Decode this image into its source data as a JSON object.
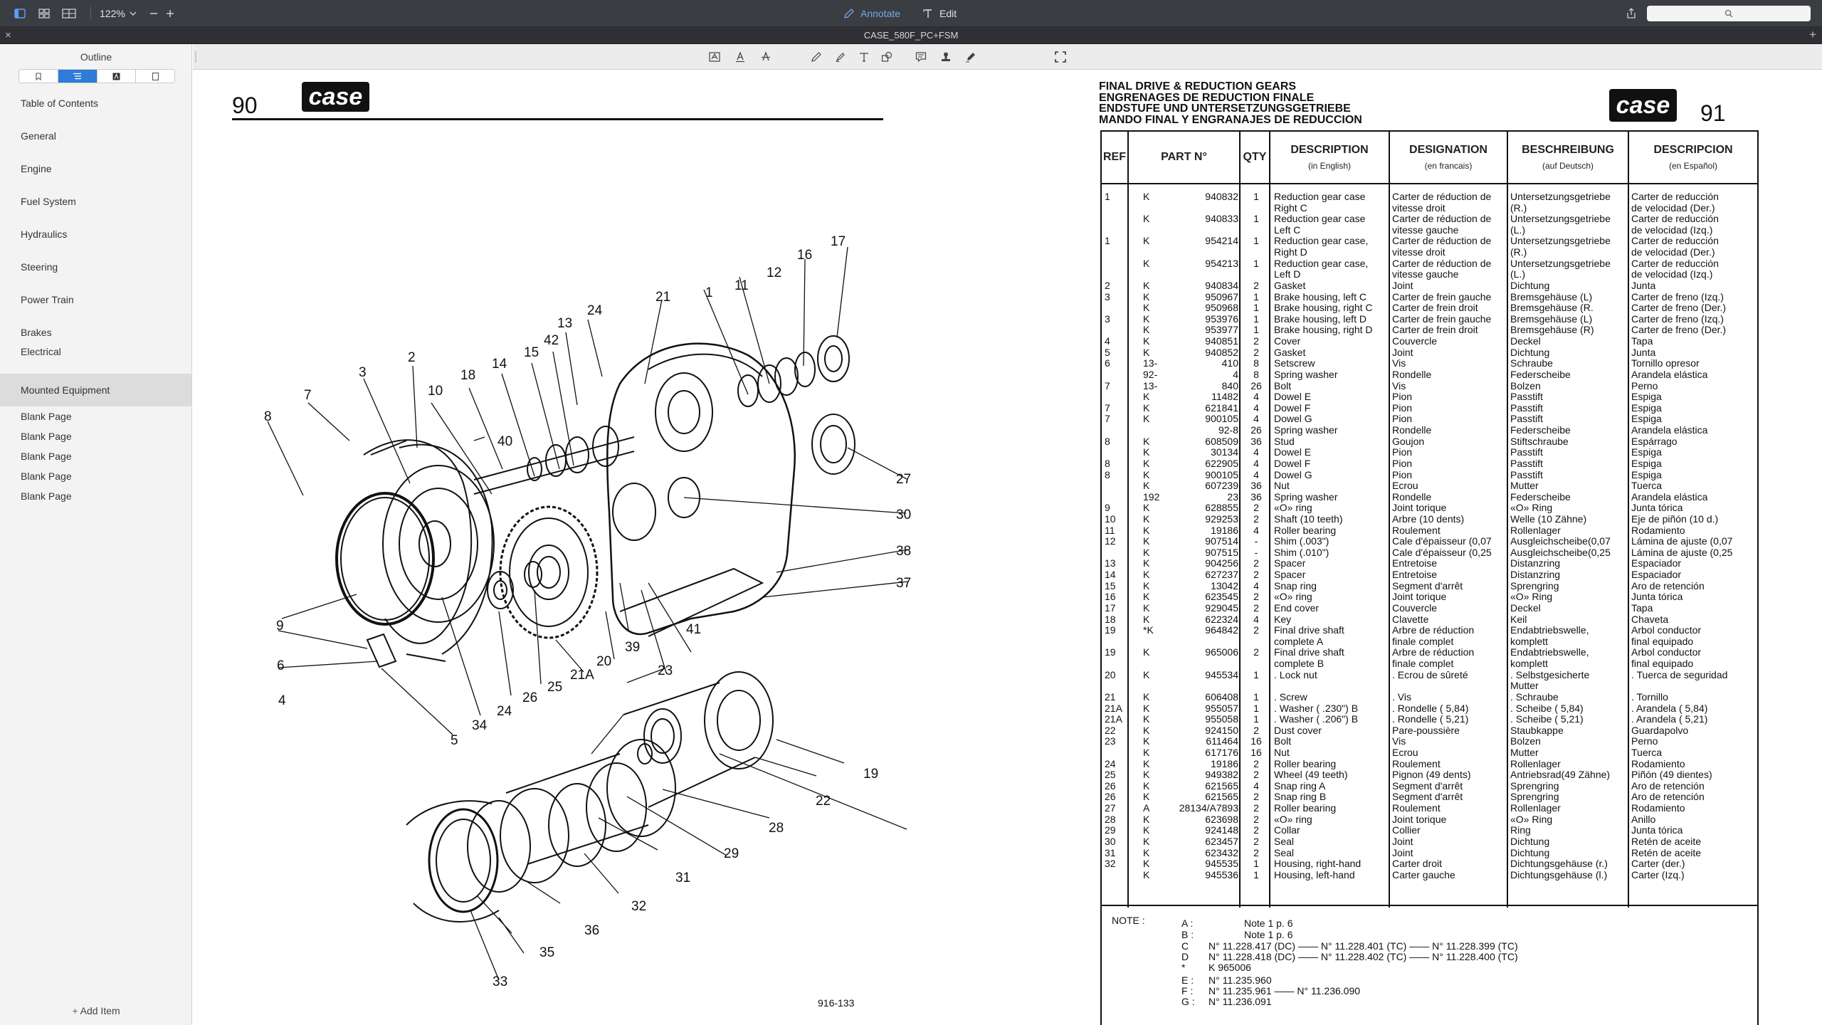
{
  "toolbar": {
    "zoom": "122%",
    "annotate_label": "Annotate",
    "edit_label": "Edit"
  },
  "titlebar": {
    "title": "CASE_580F_PC+FSM"
  },
  "sidebar": {
    "title": "Outline",
    "items": [
      {
        "label": "Table of Contents"
      },
      {
        "label": "General"
      },
      {
        "label": "Engine"
      },
      {
        "label": "Fuel System"
      },
      {
        "label": "Hydraulics"
      },
      {
        "label": "Steering"
      },
      {
        "label": "Power Train"
      },
      {
        "label": "Brakes"
      },
      {
        "label": "Electrical"
      },
      {
        "label": "Mounted Equipment"
      },
      {
        "label": "Blank Page"
      },
      {
        "label": "Blank Page"
      },
      {
        "label": "Blank Page"
      },
      {
        "label": "Blank Page"
      },
      {
        "label": "Blank Page"
      }
    ],
    "add_item": "Add Item"
  },
  "doc": {
    "left_page": "90",
    "right_page": "91",
    "logo": "case",
    "figure_code": "916-133",
    "heading": [
      "FINAL DRIVE & REDUCTION GEARS",
      "ENGRENAGES DE REDUCTION FINALE",
      "ENDSTUFE UND UNTERSETZUNGSGETRIEBE",
      "MANDO FINAL Y ENGRANAJES DE REDUCCION"
    ],
    "table_headers": {
      "ref": "REF",
      "part": "PART N°",
      "qty": "QTY",
      "desc_en": "DESCRIPTION",
      "desc_en_sub": "(in English)",
      "desc_fr": "DESIGNATION",
      "desc_fr_sub": "(en francais)",
      "desc_de": "BESCHREIBUNG",
      "desc_de_sub": "(auf Deutsch)",
      "desc_es": "DESCRIPCION",
      "desc_es_sub": "(en Español)"
    },
    "rows": [
      {
        "ref": "1",
        "k": "K",
        "part": "940832",
        "qty": "1",
        "en": "Reduction gear case",
        "fr": "Carter de réduction de",
        "de": "Untersetzungsgetriebe",
        "es": "Carter de reducción"
      },
      {
        "ref": "",
        "k": "",
        "part": "",
        "qty": "",
        "en": "Right            C",
        "fr": "vitesse droit",
        "de": "(R.)",
        "es": "de velocidad (Der.)"
      },
      {
        "ref": "",
        "k": "K",
        "part": "940833",
        "qty": "1",
        "en": "Reduction gear case",
        "fr": "Carter de réduction de",
        "de": "Untersetzungsgetriebe",
        "es": "Carter de reducción"
      },
      {
        "ref": "",
        "k": "",
        "part": "",
        "qty": "",
        "en": "Left               C",
        "fr": "vitesse gauche",
        "de": "(L.)",
        "es": "de velocidad (Izq.)"
      },
      {
        "ref": "1",
        "k": "K",
        "part": "954214",
        "qty": "1",
        "en": "Reduction gear case,",
        "fr": "Carter de réduction de",
        "de": "Untersetzungsgetriebe",
        "es": "Carter de reducción"
      },
      {
        "ref": "",
        "k": "",
        "part": "",
        "qty": "",
        "en": "Right            D",
        "fr": "vitesse droit",
        "de": "(R.)",
        "es": "de velocidad (Der.)"
      },
      {
        "ref": "",
        "k": "K",
        "part": "954213",
        "qty": "1",
        "en": "Reduction gear case,",
        "fr": "Carter de réduction de",
        "de": "Untersetzungsgetriebe",
        "es": "Carter de reducción"
      },
      {
        "ref": "",
        "k": "",
        "part": "",
        "qty": "",
        "en": "Left               D",
        "fr": "vitesse gauche",
        "de": "(L.)",
        "es": "de velocidad (Izq.)"
      },
      {
        "ref": "2",
        "k": "K",
        "part": "940834",
        "qty": "2",
        "en": "Gasket",
        "fr": "Joint",
        "de": "Dichtung",
        "es": "Junta"
      },
      {
        "ref": "3",
        "k": "K",
        "part": "950967",
        "qty": "1",
        "en": "Brake housing, left C",
        "fr": "Carter de frein gauche",
        "de": "Bremsgehäuse (L)",
        "es": "Carter de freno (Izq.)"
      },
      {
        "ref": "",
        "k": "K",
        "part": "950968",
        "qty": "1",
        "en": "Brake housing, right C",
        "fr": "Carter de frein droit",
        "de": "Bremsgehäuse (R.",
        "es": "Carter de freno (Der.)"
      },
      {
        "ref": "3",
        "k": "K",
        "part": "953976",
        "qty": "1",
        "en": "Brake housing, left D",
        "fr": "Carter de frein gauche",
        "de": "Bremsgehäuse (L)",
        "es": "Carter de freno (Izq.)"
      },
      {
        "ref": "",
        "k": "K",
        "part": "953977",
        "qty": "1",
        "en": "Brake housing, right D",
        "fr": "Carter de frein droit",
        "de": "Bremsgehäuse (R)",
        "es": "Carter de freno (Der.)"
      },
      {
        "ref": "4",
        "k": "K",
        "part": "940851",
        "qty": "2",
        "en": "Cover",
        "fr": "Couvercle",
        "de": "Deckel",
        "es": "Tapa"
      },
      {
        "ref": "5",
        "k": "K",
        "part": "940852",
        "qty": "2",
        "en": "Gasket",
        "fr": "Joint",
        "de": "Dichtung",
        "es": "Junta"
      },
      {
        "ref": "6",
        "k": "13-",
        "part": "410",
        "qty": "8",
        "en": "Setscrew",
        "fr": "Vis",
        "de": "Schraube",
        "es": "Tornillo opresor"
      },
      {
        "ref": "",
        "k": "92-",
        "part": "4",
        "qty": "8",
        "en": "Spring washer",
        "fr": "Rondelle",
        "de": "Federscheibe",
        "es": "Arandela elástica"
      },
      {
        "ref": "7",
        "k": "13-",
        "part": "840",
        "qty": "26",
        "en": "Bolt",
        "fr": "Vis",
        "de": "Bolzen",
        "es": "Perno"
      },
      {
        "ref": "",
        "k": "K",
        "part": "11482",
        "qty": "4",
        "en": "Dowel             E",
        "fr": "Pion",
        "de": "Passtift",
        "es": "Espiga"
      },
      {
        "ref": "7",
        "k": "K",
        "part": "621841",
        "qty": "4",
        "en": "Dowel             F",
        "fr": "Pion",
        "de": "Passtift",
        "es": "Espiga"
      },
      {
        "ref": "7",
        "k": "K",
        "part": "900105",
        "qty": "4",
        "en": "Dowel             G",
        "fr": "Pion",
        "de": "Passtift",
        "es": "Espiga"
      },
      {
        "ref": "",
        "k": "",
        "part": "92-8",
        "qty": "26",
        "en": "Spring washer",
        "fr": "Rondelle",
        "de": "Federscheibe",
        "es": "Arandela elástica"
      },
      {
        "ref": "8",
        "k": "K",
        "part": "608509",
        "qty": "36",
        "en": "Stud",
        "fr": "Goujon",
        "de": "Stiftschraube",
        "es": "Espárrago"
      },
      {
        "ref": "",
        "k": "K",
        "part": "30134",
        "qty": "4",
        "en": "Dowel             E",
        "fr": "Pion",
        "de": "Passtift",
        "es": "Espiga"
      },
      {
        "ref": "8",
        "k": "K",
        "part": "622905",
        "qty": "4",
        "en": "Dowel             F",
        "fr": "Pion",
        "de": "Passtift",
        "es": "Espiga"
      },
      {
        "ref": "8",
        "k": "K",
        "part": "900105",
        "qty": "4",
        "en": "Dowel             G",
        "fr": "Pion",
        "de": "Passtift",
        "es": "Espiga"
      },
      {
        "ref": "",
        "k": "K",
        "part": "607239",
        "qty": "36",
        "en": "Nut",
        "fr": "Ecrou",
        "de": "Mutter",
        "es": "Tuerca"
      },
      {
        "ref": "",
        "k": "192",
        "part": "23",
        "qty": "36",
        "en": "Spring washer",
        "fr": "Rondelle",
        "de": "Federscheibe",
        "es": "Arandela elástica"
      },
      {
        "ref": "9",
        "k": "K",
        "part": "628855",
        "qty": "2",
        "en": "«O» ring",
        "fr": "Joint torique",
        "de": "«O» Ring",
        "es": "Junta tórica"
      },
      {
        "ref": "10",
        "k": "K",
        "part": "929253",
        "qty": "2",
        "en": "Shaft (10 teeth)",
        "fr": "Arbre (10 dents)",
        "de": "Welle (10 Zähne)",
        "es": "Eje de piñón (10 d.)"
      },
      {
        "ref": "11",
        "k": "K",
        "part": "19186",
        "qty": "4",
        "en": "Roller bearing",
        "fr": "Roulement",
        "de": "Rollenlager",
        "es": "Rodamiento"
      },
      {
        "ref": "12",
        "k": "K",
        "part": "907514",
        "qty": "-",
        "en": "Shim (.003\")",
        "fr": "Cale d'épaisseur (0,07",
        "de": "Ausgleichscheibe(0,07",
        "es": "Lámina de ajuste (0,07"
      },
      {
        "ref": "",
        "k": "K",
        "part": "907515",
        "qty": "-",
        "en": "Shim (.010\")",
        "fr": "Cale d'épaisseur (0,25",
        "de": "Ausgleichscheibe(0,25",
        "es": "Lámina de ajuste (0,25"
      },
      {
        "ref": "13",
        "k": "K",
        "part": "904256",
        "qty": "2",
        "en": "Spacer",
        "fr": "Entretoise",
        "de": "Distanzring",
        "es": "Espaciador"
      },
      {
        "ref": "14",
        "k": "K",
        "part": "627237",
        "qty": "2",
        "en": "Spacer",
        "fr": "Entretoise",
        "de": "Distanzring",
        "es": "Espaciador"
      },
      {
        "ref": "15",
        "k": "K",
        "part": "13042",
        "qty": "4",
        "en": "Snap ring",
        "fr": "Segment d'arrêt",
        "de": "Sprengring",
        "es": "Aro de retención"
      },
      {
        "ref": "16",
        "k": "K",
        "part": "623545",
        "qty": "2",
        "en": "«O» ring",
        "fr": "Joint torique",
        "de": "«O» Ring",
        "es": "Junta tórica"
      },
      {
        "ref": "17",
        "k": "K",
        "part": "929045",
        "qty": "2",
        "en": "End cover",
        "fr": "Couvercle",
        "de": "Deckel",
        "es": "Tapa"
      },
      {
        "ref": "18",
        "k": "K",
        "part": "622324",
        "qty": "4",
        "en": "Key",
        "fr": "Clavette",
        "de": "Keil",
        "es": "Chaveta"
      },
      {
        "ref": "19",
        "k": "*K",
        "part": "964842",
        "qty": "2",
        "en": "Final drive shaft",
        "fr": "Arbre de réduction",
        "de": "Endabtriebswelle,",
        "es": "Arbol conductor"
      },
      {
        "ref": "",
        "k": "",
        "part": "",
        "qty": "",
        "en": "complete          A",
        "fr": "finale complet",
        "de": "komplett",
        "es": "final equipado"
      },
      {
        "ref": "19",
        "k": "K",
        "part": "965006",
        "qty": "2",
        "en": "Final drive shaft",
        "fr": "Arbre de réduction",
        "de": "Endabtriebswelle,",
        "es": "Arbol conductor"
      },
      {
        "ref": "",
        "k": "",
        "part": "",
        "qty": "",
        "en": "complete          B",
        "fr": "finale complet",
        "de": "komplett",
        "es": "final equipado"
      },
      {
        "ref": "20",
        "k": "K",
        "part": "945534",
        "qty": "1",
        "en": ". Lock nut",
        "fr": ". Ecrou de sûreté",
        "de": ". Selbstgesicherte",
        "es": ". Tuerca de seguridad"
      },
      {
        "ref": "",
        "k": "",
        "part": "",
        "qty": "",
        "en": "",
        "fr": "",
        "de": "Mutter",
        "es": ""
      },
      {
        "ref": "21",
        "k": "K",
        "part": "606408",
        "qty": "1",
        "en": ". Screw",
        "fr": ". Vis",
        "de": ". Schraube",
        "es": ". Tornillo"
      },
      {
        "ref": "21A",
        "k": "K",
        "part": "955057",
        "qty": "1",
        "en": ". Washer ( .230\") B",
        "fr": ". Rondelle ( 5,84)",
        "de": ". Scheibe ( 5,84)",
        "es": ". Arandela ( 5,84)"
      },
      {
        "ref": "21A",
        "k": "K",
        "part": "955058",
        "qty": "1",
        "en": ". Washer ( .206\") B",
        "fr": ". Rondelle ( 5,21)",
        "de": ". Scheibe ( 5,21)",
        "es": ". Arandela ( 5,21)"
      },
      {
        "ref": "22",
        "k": "K",
        "part": "924150",
        "qty": "2",
        "en": "Dust cover",
        "fr": "Pare-poussière",
        "de": "Staubkappe",
        "es": "Guardapolvo"
      },
      {
        "ref": "23",
        "k": "K",
        "part": "611464",
        "qty": "16",
        "en": "Bolt",
        "fr": "Vis",
        "de": "Bolzen",
        "es": "Perno"
      },
      {
        "ref": "",
        "k": "K",
        "part": "617176",
        "qty": "16",
        "en": "Nut",
        "fr": "Ecrou",
        "de": "Mutter",
        "es": "Tuerca"
      },
      {
        "ref": "24",
        "k": "K",
        "part": "19186",
        "qty": "2",
        "en": "Roller bearing",
        "fr": "Roulement",
        "de": "Rollenlager",
        "es": "Rodamiento"
      },
      {
        "ref": "25",
        "k": "K",
        "part": "949382",
        "qty": "2",
        "en": "Wheel (49 teeth)",
        "fr": "Pignon (49 dents)",
        "de": "Antriebsrad(49 Zähne)",
        "es": "Piñón (49 dientes)"
      },
      {
        "ref": "26",
        "k": "K",
        "part": "621565",
        "qty": "4",
        "en": "Snap ring          A",
        "fr": "Segment d'arrêt",
        "de": "Sprengring",
        "es": "Aro de retención"
      },
      {
        "ref": "26",
        "k": "K",
        "part": "621565",
        "qty": "2",
        "en": "Snap ring          B",
        "fr": "Segment d'arrêt",
        "de": "Sprengring",
        "es": "Aro de retención"
      },
      {
        "ref": "27",
        "k": "A",
        "part": "28134/A7893",
        "qty": "2",
        "en": "Roller bearing",
        "fr": "Roulement",
        "de": "Rollenlager",
        "es": "Rodamiento"
      },
      {
        "ref": "28",
        "k": "K",
        "part": "623698",
        "qty": "2",
        "en": "«O» ring",
        "fr": "Joint torique",
        "de": "«O» Ring",
        "es": "Anillo"
      },
      {
        "ref": "29",
        "k": "K",
        "part": "924148",
        "qty": "2",
        "en": "Collar",
        "fr": "Collier",
        "de": "Ring",
        "es": "Junta tórica"
      },
      {
        "ref": "30",
        "k": "K",
        "part": "623457",
        "qty": "2",
        "en": "Seal",
        "fr": "Joint",
        "de": "Dichtung",
        "es": "Retén de aceite"
      },
      {
        "ref": "31",
        "k": "K",
        "part": "623432",
        "qty": "2",
        "en": "Seal",
        "fr": "Joint",
        "de": "Dichtung",
        "es": "Retén de aceite"
      },
      {
        "ref": "32",
        "k": "K",
        "part": "945535",
        "qty": "1",
        "en": "Housing, right-hand",
        "fr": "Carter droit",
        "de": "Dichtungsgehäuse (r.)",
        "es": "Carter (der.)"
      },
      {
        "ref": "",
        "k": "K",
        "part": "945536",
        "qty": "1",
        "en": "Housing, left-hand",
        "fr": "Carter gauche",
        "de": "Dichtungsgehäuse (l.)",
        "es": "Carter (Izq.)"
      }
    ],
    "note_label": "NOTE :",
    "notes": [
      {
        "key": "A :",
        "text": "Note 1 p. 6"
      },
      {
        "key": "B :",
        "text": "Note 1 p. 6"
      },
      {
        "key": "C",
        "text": "N° 11.228.417   (DC)  ——  N° 11.228.401   (TC)  ——  N° 11.228.399 (TC)"
      },
      {
        "key": "D",
        "text": "N° 11.228.418   (DC)  ——  N° 11.228.402   (TC)  ——  N° 11.228.400 (TC)"
      },
      {
        "key": "*",
        "text": "K 965006"
      },
      {
        "key": "E :",
        "text": "N° 11.235.960"
      },
      {
        "key": "F :",
        "text": "N° 11.235.961   ——  N° 11.236.090"
      },
      {
        "key": "G :",
        "text": "N° 11.236.091"
      }
    ],
    "callouts": [
      "1",
      "2",
      "3",
      "4",
      "5",
      "6",
      "7",
      "8",
      "9",
      "10",
      "11",
      "12",
      "13",
      "14",
      "15",
      "16",
      "17",
      "18",
      "19",
      "20",
      "21",
      "21A",
      "22",
      "23",
      "24",
      "24",
      "25",
      "26",
      "27",
      "28",
      "29",
      "30",
      "31",
      "32",
      "33",
      "34",
      "35",
      "36",
      "37",
      "38",
      "39",
      "40",
      "41",
      "42"
    ]
  },
  "colors": {
    "toolbar": "#3a3d42",
    "accent": "#2e7bd8",
    "annotate": "#7aa7e8"
  }
}
